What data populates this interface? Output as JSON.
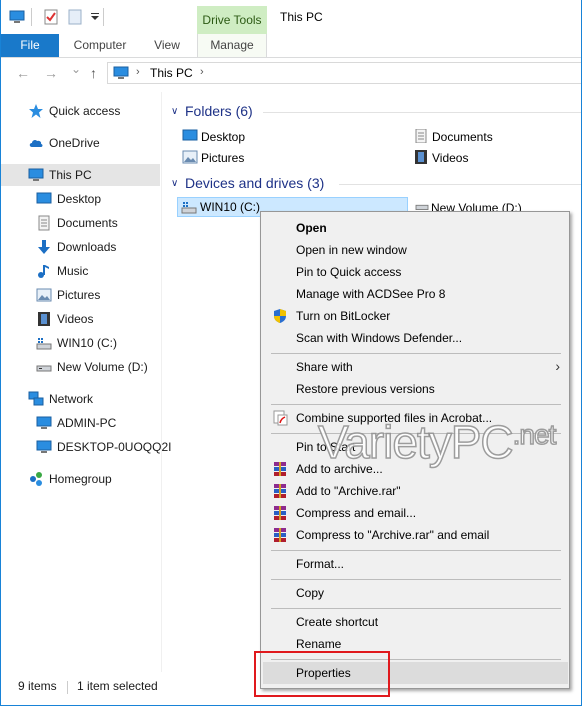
{
  "titlebar": {
    "contextual_group": "Drive Tools",
    "window_title": "This PC"
  },
  "ribbon": {
    "tabs": [
      {
        "label": "File"
      },
      {
        "label": "Computer"
      },
      {
        "label": "View"
      },
      {
        "label": "Manage"
      }
    ]
  },
  "address": {
    "back_icon": "←",
    "forward_icon": "→",
    "history_icon": "⌄",
    "up_icon": "↑",
    "crumb": "This PC",
    "chevron": "›"
  },
  "sidebar": {
    "items": [
      {
        "label": "Quick access",
        "icon": "star-icon"
      },
      {
        "label": "OneDrive",
        "icon": "cloud-icon"
      },
      {
        "label": "This PC",
        "icon": "computer-icon"
      },
      {
        "label": "Desktop",
        "icon": "desktop-icon"
      },
      {
        "label": "Documents",
        "icon": "documents-icon"
      },
      {
        "label": "Downloads",
        "icon": "download-icon"
      },
      {
        "label": "Music",
        "icon": "music-icon"
      },
      {
        "label": "Pictures",
        "icon": "pictures-icon"
      },
      {
        "label": "Videos",
        "icon": "videos-icon"
      },
      {
        "label": "WIN10 (C:)",
        "icon": "drive-icon"
      },
      {
        "label": "New Volume (D:)",
        "icon": "drive-icon"
      },
      {
        "label": "Network",
        "icon": "network-icon"
      },
      {
        "label": "ADMIN-PC",
        "icon": "computer-icon"
      },
      {
        "label": "DESKTOP-0UOQQ2I",
        "icon": "computer-icon"
      },
      {
        "label": "Homegroup",
        "icon": "homegroup-icon"
      }
    ]
  },
  "content": {
    "folders_header": "Folders (6)",
    "devices_header": "Devices and drives (3)",
    "folders": [
      {
        "label": "Desktop"
      },
      {
        "label": "Documents"
      },
      {
        "label": "Pictures"
      },
      {
        "label": "Videos"
      }
    ],
    "drives": [
      {
        "label": "WIN10 (C:)"
      },
      {
        "label": "New Volume (D:)"
      }
    ]
  },
  "status": {
    "items_count": "9 items",
    "selected": "1 item selected"
  },
  "context_menu": {
    "items": [
      {
        "label": "Open"
      },
      {
        "label": "Open in new window"
      },
      {
        "label": "Pin to Quick access"
      },
      {
        "label": "Manage with ACDSee Pro 8"
      },
      {
        "label": "Turn on BitLocker"
      },
      {
        "label": "Scan with Windows Defender..."
      },
      {
        "label": "Share with"
      },
      {
        "label": "Restore previous versions"
      },
      {
        "label": "Combine supported files in Acrobat..."
      },
      {
        "label": "Pin to Start"
      },
      {
        "label": "Add to archive..."
      },
      {
        "label": "Add to \"Archive.rar\""
      },
      {
        "label": "Compress and email..."
      },
      {
        "label": "Compress to \"Archive.rar\" and email"
      },
      {
        "label": "Format..."
      },
      {
        "label": "Copy"
      },
      {
        "label": "Create shortcut"
      },
      {
        "label": "Rename"
      },
      {
        "label": "Properties"
      }
    ],
    "submenu_arrow": "›"
  },
  "watermark": {
    "main": "VarietyPC",
    "suffix": ".net"
  },
  "colors": {
    "accent": "#1979ca",
    "selection": "#cce8ff",
    "group_header": "#1e3287",
    "drive_tools": "#cfedc3",
    "highlight_box": "#e0191d"
  }
}
